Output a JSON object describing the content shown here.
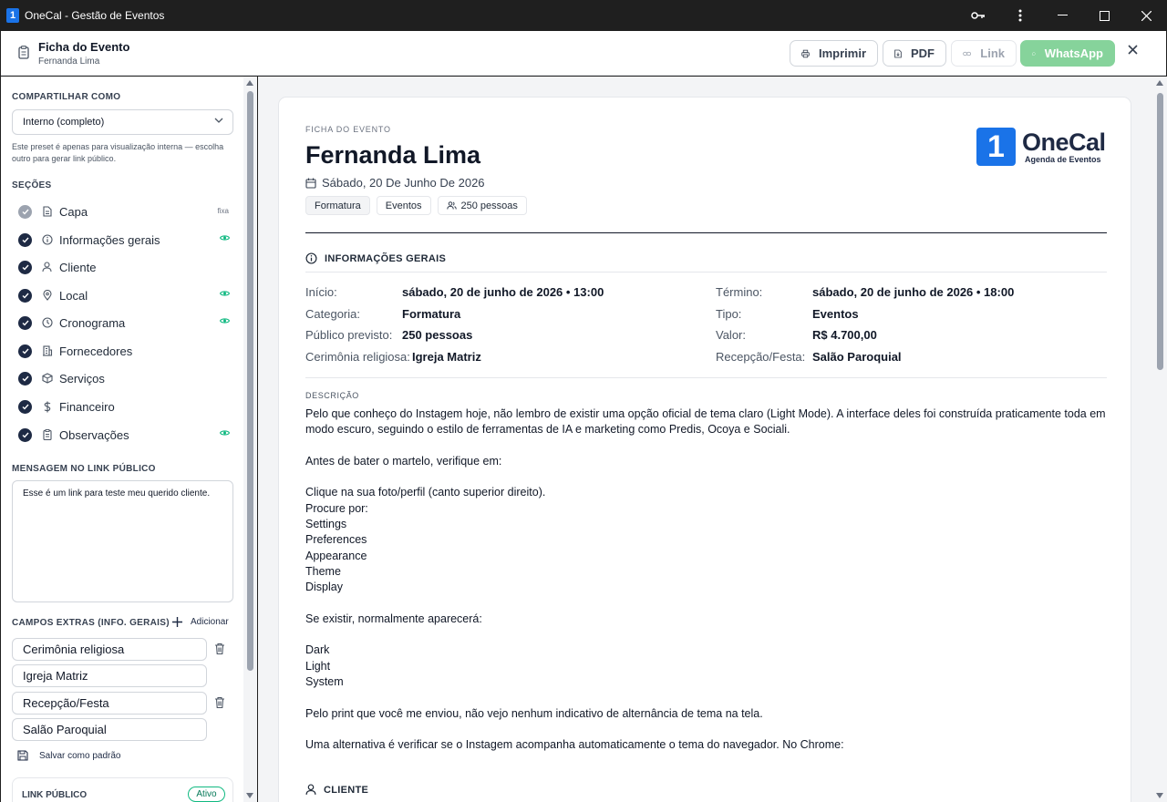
{
  "window": {
    "title": "OneCal - Gestão de Eventos"
  },
  "header": {
    "title": "Ficha do Evento",
    "subtitle": "Fernanda Lima",
    "buttons": {
      "print": "Imprimir",
      "pdf": "PDF",
      "link": "Link",
      "whatsapp": "WhatsApp"
    }
  },
  "sidebar": {
    "share_label": "COMPARTILHAR COMO",
    "share_value": "Interno (completo)",
    "share_hint": "Este preset é apenas para visualização interna — escolha outro para gerar link público.",
    "sections_label": "SEÇÕES",
    "sections": [
      {
        "label": "Capa",
        "badge": "fixa",
        "icon": "document-icon"
      },
      {
        "label": "Informações gerais",
        "icon": "info-icon",
        "visible": true
      },
      {
        "label": "Cliente",
        "icon": "user-icon"
      },
      {
        "label": "Local",
        "icon": "location-pin-icon",
        "visible": true
      },
      {
        "label": "Cronograma",
        "icon": "clock-icon",
        "visible": true
      },
      {
        "label": "Fornecedores",
        "icon": "building-icon"
      },
      {
        "label": "Serviços",
        "icon": "box-icon"
      },
      {
        "label": "Financeiro",
        "icon": "dollar-icon"
      },
      {
        "label": "Observações",
        "icon": "clipboard-icon",
        "visible": true
      }
    ],
    "message_label": "MENSAGEM NO LINK PÚBLICO",
    "message_value": "Esse é um link para teste meu querido cliente.",
    "extra_label": "CAMPOS EXTRAS (INFO. GERAIS)",
    "add_label": "Adicionar",
    "extra_fields": [
      "Cerimônia religiosa",
      "Igreja Matriz",
      "Recepção/Festa",
      "Salão Paroquial"
    ],
    "save_default": "Salvar como padrão",
    "public_link_label": "LINK PÚBLICO",
    "public_link_status": "Ativo"
  },
  "document": {
    "eyebrow": "FICHA DO EVENTO",
    "name": "Fernanda Lima",
    "date": "Sábado, 20 De Junho De 2026",
    "tags": [
      "Formatura",
      "Eventos",
      "250 pessoas"
    ],
    "logo": {
      "name": "OneCal",
      "digit": "1",
      "tagline": "Agenda de Eventos"
    },
    "info_title": "INFORMAÇÕES GERAIS",
    "info": {
      "inicio_k": "Início:",
      "inicio_v": "sábado, 20 de junho de 2026 • 13:00",
      "termino_k": "Término:",
      "termino_v": "sábado, 20 de junho de 2026 • 18:00",
      "categoria_k": "Categoria:",
      "categoria_v": "Formatura",
      "tipo_k": "Tipo:",
      "tipo_v": "Eventos",
      "publico_k": "Público previsto:",
      "publico_v": "250 pessoas",
      "valor_k": "Valor:",
      "valor_v": "R$ 4.700,00",
      "cerimonia_k": "Cerimônia religiosa:",
      "cerimonia_v": "Igreja Matriz",
      "recepcao_k": "Recepção/Festa:",
      "recepcao_v": "Salão Paroquial"
    },
    "desc_label": "DESCRIÇÃO",
    "description": "Pelo que conheço do Instagem hoje, não lembro de existir uma opção oficial de tema claro (Light Mode). A interface deles foi construída praticamente toda em modo escuro, seguindo o estilo de ferramentas de IA e marketing como Predis, Ocoya e Sociali.\n\nAntes de bater o martelo, verifique em:\n\nClique na sua foto/perfil (canto superior direito).\nProcure por:\nSettings\nPreferences\nAppearance\nTheme\nDisplay\n\nSe existir, normalmente aparecerá:\n\nDark\nLight\nSystem\n\nPelo print que você me enviou, não vejo nenhum indicativo de alternância de tema na tela.\n\nUma alternativa é verificar se o Instagem acompanha automaticamente o tema do navegador. No Chrome:",
    "client_title": "CLIENTE"
  },
  "colors": {
    "brand": "#1a73e8",
    "navy": "#1e2a44",
    "whatsapp": "#86d39b",
    "visible_eye": "#10b981"
  }
}
